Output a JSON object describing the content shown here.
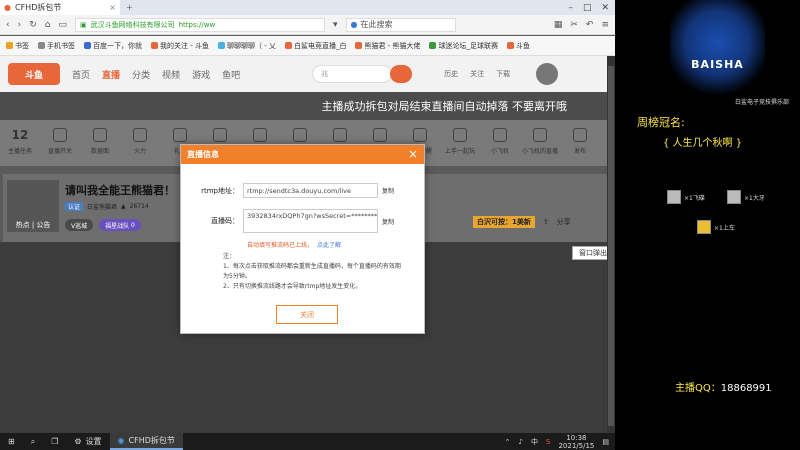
{
  "browser": {
    "tab_title": "CFHD拆包节",
    "organization": "武汉斗鱼网络科技有限公司",
    "url": "https://ww",
    "search_placeholder": "在此搜索"
  },
  "bookmarks": [
    "书签",
    "手机书签",
    "百度一下，你就",
    "我的关注 - 斗鱼",
    "聊聊聊聊（ - 乂",
    "白鲨电竞直播_白",
    "熊猫君 - 熊猫大佬",
    "球迷论坛_足球联赛",
    "斗鱼"
  ],
  "site": {
    "logo": "斗鱼",
    "nav": [
      "首页",
      "直播",
      "分类",
      "视频",
      "游戏",
      "鱼吧"
    ],
    "search_placeholder": "兆",
    "header_icons": [
      "历史",
      "关注",
      "下载"
    ]
  },
  "notice": "主播成功拆包对局结束直播间自动掉落 不要离开哦",
  "toolbar": {
    "count": "12",
    "items": [
      "主播任务",
      "直播开关",
      "数据面",
      "火力",
      "礼物",
      "",
      "",
      "",
      "",
      "",
      "直播提醒",
      "上手一起玩",
      "小飞机",
      "小飞机的直播",
      "发布"
    ]
  },
  "room": {
    "cover_label": "热点 | 公告",
    "title": "请叫我全能王熊猫君！",
    "badge": "认证",
    "owner": "白鲨熊猫君",
    "viewers": "26714",
    "btn_vip": "V巡城",
    "btn_club": "福星战队",
    "btn_club_count": "0",
    "gift_label": "白沢可按：1美新",
    "share": "分享"
  },
  "popout": "窗口弹出",
  "dialog": {
    "title": "直播信息",
    "rtmp_label": "rtmp地址：",
    "rtmp_value": "rtmp://sendtc3a.douyu.com/live",
    "code_label": "直播码：",
    "code_value": "3932834rxDQPh7gn?wsSecret=*********",
    "copy": "复制",
    "warn": "自动填写推流码已上线，",
    "warn_link": "点此了解",
    "notes_title": "注：",
    "note1": "1、每次点击获取推流码都会重新生成直播码，每个直播码的有效期为5分钟。",
    "note2": "2、只有切换推流线路才会导致rtmp地址发生变化。",
    "close_btn": "关闭"
  },
  "side": {
    "team_name": "BAISHA",
    "team_sub": "白鲨电子竞技俱乐部",
    "rank_title": "周榜冠名:",
    "rank_name": "{ 人生几个秋啊 }",
    "gifts": [
      "×1飞碟",
      "×1大牙",
      "×1上车"
    ],
    "qq_label": "主播QQ：",
    "qq_value": "18868991"
  },
  "taskbar": {
    "settings": "设置",
    "app": "CFHD拆包节",
    "lang": "中",
    "time": "10:38",
    "date": "2021/5/15"
  },
  "colors": {
    "accent": "#f27f2a",
    "side_text": "#ffe84a"
  }
}
